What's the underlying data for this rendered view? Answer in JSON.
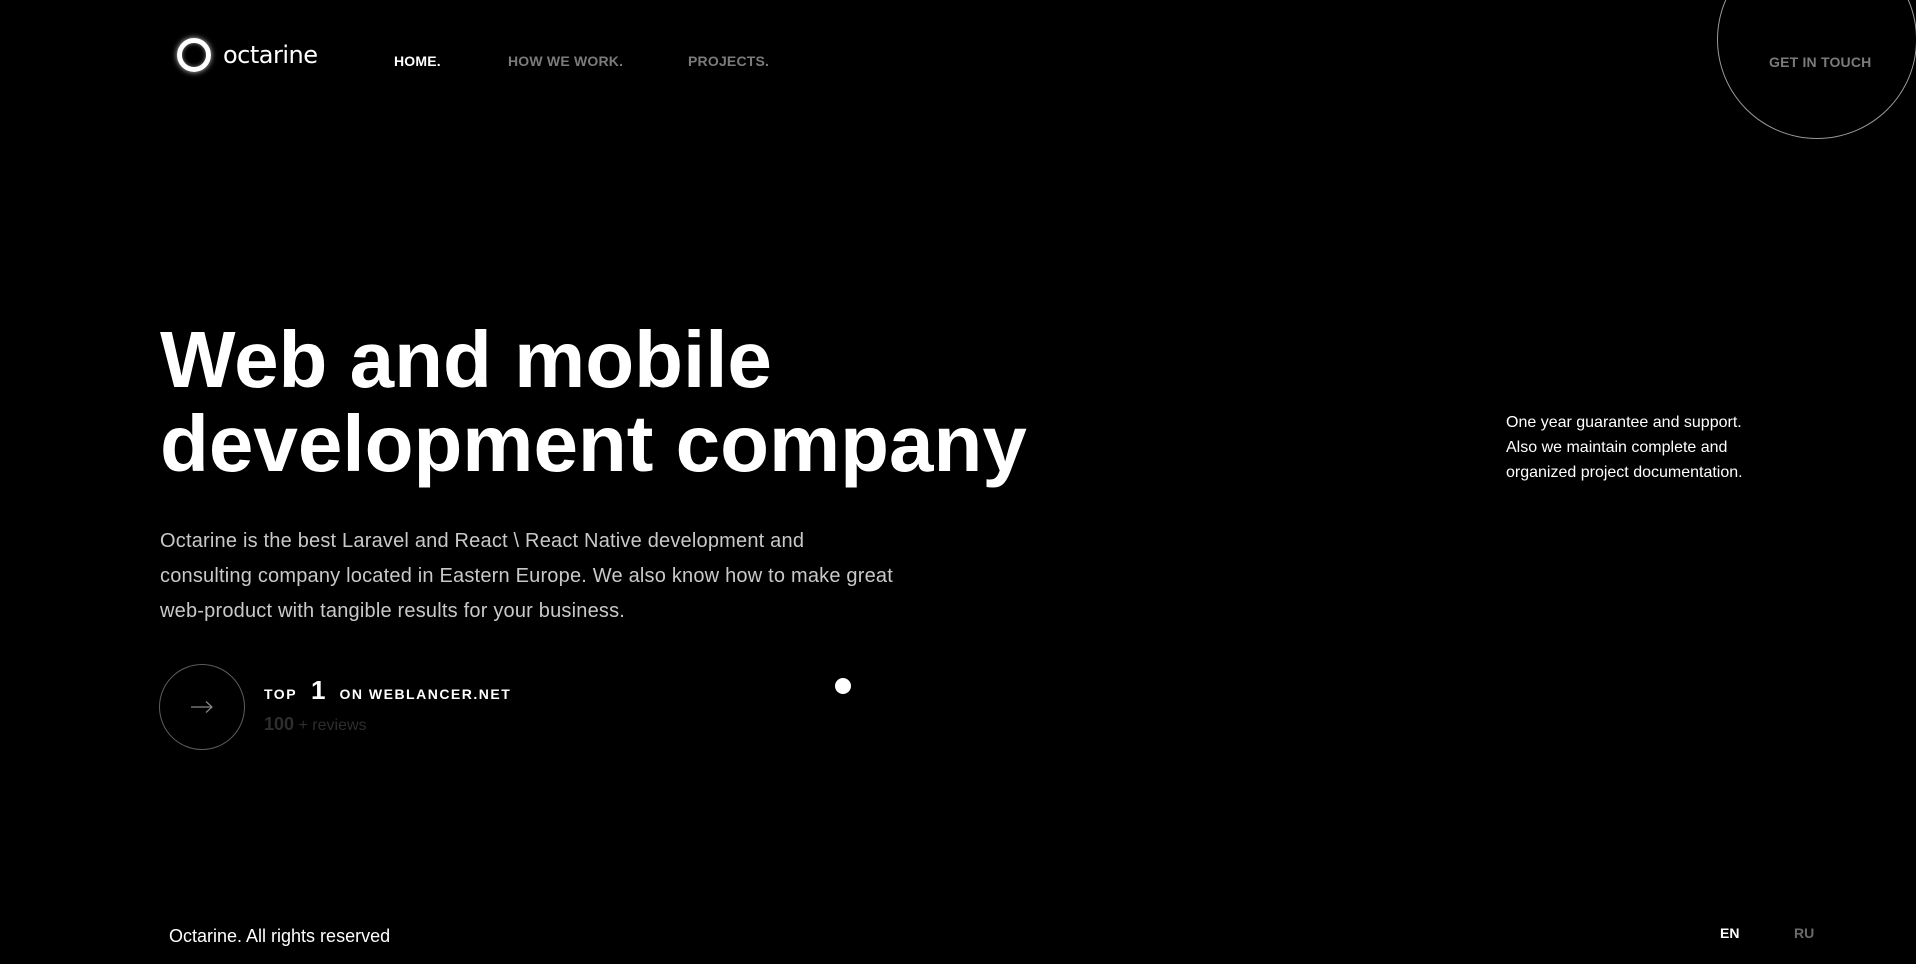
{
  "brand": {
    "name": "octarine",
    "logo_icon": "ring-logo-icon"
  },
  "nav": {
    "items": [
      {
        "label": "HOME.",
        "active": true
      },
      {
        "label": "HOW WE WORK.",
        "active": false
      },
      {
        "label": "PROJECTS.",
        "active": false
      }
    ],
    "contact_label": "GET IN TOUCH"
  },
  "hero": {
    "title_lines": [
      "Web and mobile",
      "development company"
    ],
    "description_lines": [
      "Octarine is the best Laravel and React \\ React Native development and",
      "consulting company located in Eastern Europe. We also know how to make great",
      "web-product with tangible results for your business."
    ],
    "cta_icon": "arrow-right-icon",
    "rating": {
      "prefix": "TOP",
      "rank": "1",
      "suffix": "ON WEBLANCER.NET",
      "reviews_count": "100",
      "reviews_label": "+ reviews"
    }
  },
  "side_note": {
    "lines": [
      "One year guarantee and support.",
      "Also we maintain complete and",
      "organized project documentation."
    ]
  },
  "footer": {
    "copyright": "Octarine. All rights reserved",
    "languages": [
      {
        "code": "EN",
        "active": true
      },
      {
        "code": "RU",
        "active": false
      }
    ]
  },
  "colors": {
    "background": "#000000",
    "text_primary": "#ffffff",
    "nav_inactive": "#7b7b7b",
    "description": "#c9c9c9",
    "muted": "#2e2e2e"
  }
}
